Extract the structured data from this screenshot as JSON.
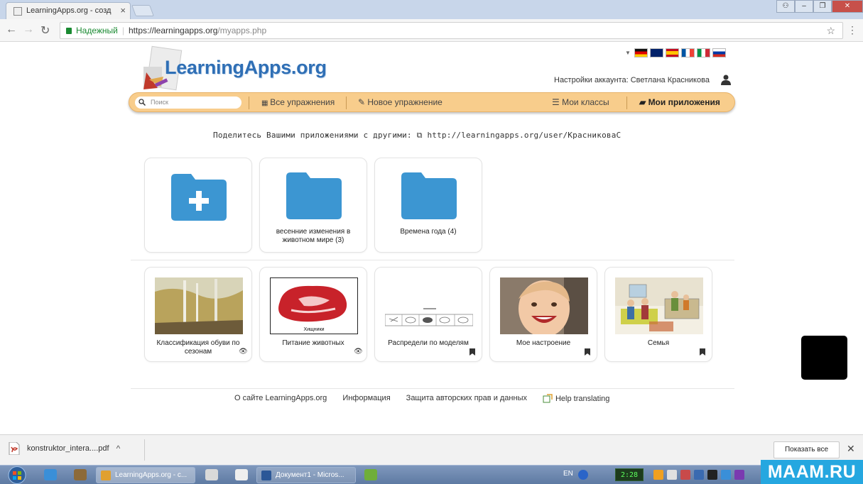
{
  "browser": {
    "tab_title": "LearningApps.org - созд",
    "tab_close": "×",
    "secure_label": "Надежный",
    "url_host": "https://learningapps.org",
    "url_path": "/myapps.php"
  },
  "site": {
    "logo_text": "LearningApps.org",
    "account_label": "Настройки аккаунта: Светлана Красникова",
    "flags": [
      "#de2910",
      "#012169",
      "#c60b1e",
      "#0055a4",
      "#009246",
      "#d52b1e"
    ]
  },
  "nav": {
    "search_placeholder": "Поиск",
    "all_exercises": "Все упражнения",
    "new_exercise": "Новое упражнение",
    "my_classes": "Мои классы",
    "my_apps": "Мои приложения"
  },
  "share": {
    "text": "Поделитесь Вашими приложениями с другими:",
    "link": "http://learningapps.org/user/КрасниковаС"
  },
  "folders": [
    {
      "label": ""
    },
    {
      "label": "весенние изменения в животном мире (3)"
    },
    {
      "label": "Времена года (4)"
    }
  ],
  "apps": [
    {
      "label": "Классификация обуви по сезонам",
      "thumb_caption": ""
    },
    {
      "label": "Питание животных",
      "thumb_caption": "Хищники"
    },
    {
      "label": "Распредели по моделям",
      "thumb_caption": ""
    },
    {
      "label": "Мое настроение",
      "thumb_caption": ""
    },
    {
      "label": "Семья",
      "thumb_caption": ""
    }
  ],
  "footer": {
    "about": "О сайте LearningApps.org",
    "info": "Информация",
    "privacy": "Защита авторских прав и данных",
    "help": "Help translating"
  },
  "downloads": {
    "file": "konstruktor_intera....pdf",
    "show_all": "Показать все"
  },
  "taskbar": {
    "chrome_label": "LearningApps.org - с...",
    "word_label": "Документ1 - Micros...",
    "lang": "EN",
    "clock": "2:28"
  },
  "watermark": "MAAM.RU",
  "colors": {
    "accent": "#2f6fb5",
    "folder": "#3c96d2",
    "nav_bg": "#f8cd8c",
    "watermark_bg": "#25a7e0"
  }
}
